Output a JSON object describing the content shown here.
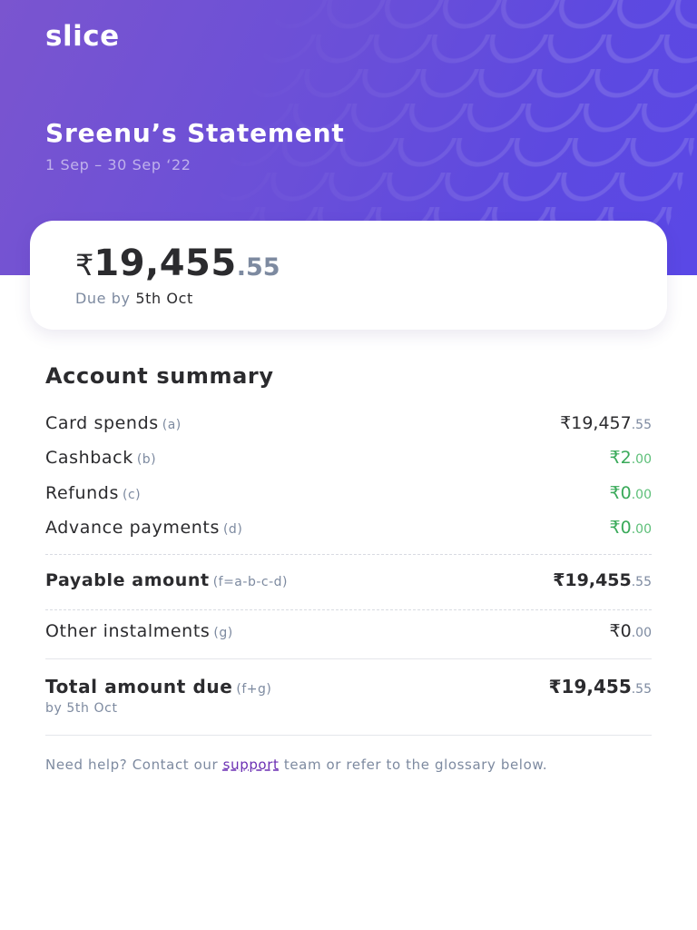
{
  "brand": {
    "logo_text": "slice",
    "accent_color": "#6a4fd8",
    "positive_color": "#3aaa5a"
  },
  "statement": {
    "title": "Sreenu’s Statement",
    "period": "1 Sep – 30 Sep ‘22"
  },
  "due_card": {
    "currency": "₹",
    "amount_int": "19,455",
    "amount_dec": ".55",
    "due_prefix": "Due by",
    "due_date": "5th Oct"
  },
  "summary": {
    "title": "Account summary",
    "rows": [
      {
        "label": "Card spends",
        "note": "(a)",
        "value_int": "₹19,457",
        "value_dec": ".55"
      },
      {
        "label": "Cashback",
        "note": "(b)",
        "value_int": "₹2",
        "value_dec": ".00"
      },
      {
        "label": "Refunds",
        "note": "(c)",
        "value_int": "₹0",
        "value_dec": ".00"
      },
      {
        "label": "Advance payments",
        "note": "(d)",
        "value_int": "₹0",
        "value_dec": ".00"
      }
    ],
    "payable": {
      "label": "Payable amount",
      "note": "(f=a-b-c-d)",
      "value_int": "₹19,455",
      "value_dec": ".55"
    },
    "other": {
      "label": "Other instalments",
      "note": "(g)",
      "value_int": "₹0",
      "value_dec": ".00"
    },
    "total": {
      "label": "Total amount due",
      "note": "(f+g)",
      "sub": "by 5th Oct",
      "value_int": "₹19,455",
      "value_dec": ".55"
    }
  },
  "help": {
    "prefix": "Need help? Contact our ",
    "link": "support",
    "suffix": " team or refer to the glossary below."
  }
}
